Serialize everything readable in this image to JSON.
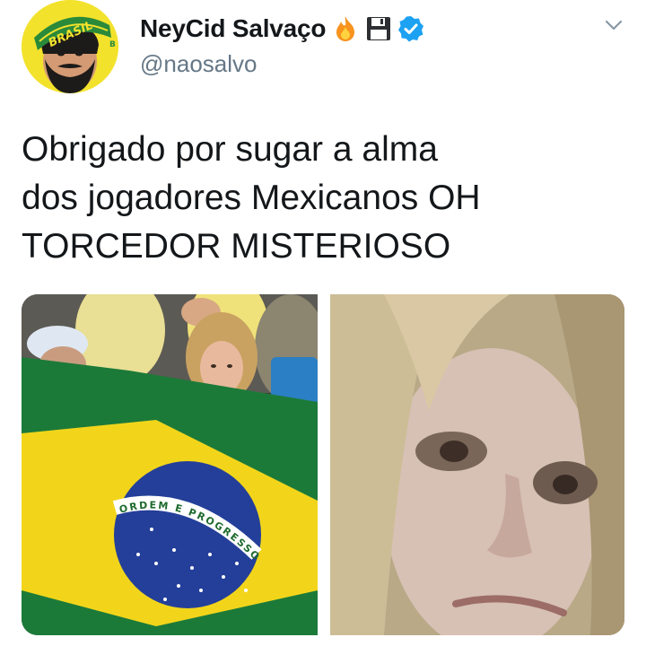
{
  "user": {
    "display_name": "NeyCid Salvaço",
    "handle": "@naosalvo",
    "name_emojis": [
      "fire-icon",
      "floppy-disk-icon",
      "verified-badge-icon"
    ],
    "avatar_band_text": "BRASIL",
    "avatar_band_letter": "B"
  },
  "tweet": {
    "text": "Obrigado por sugar a alma\ndos jogadores Mexicanos OH\nTORCEDOR MISTERIOSO"
  },
  "media": {
    "left_image": "fans-with-brazil-flag-photo",
    "right_image": "blond-long-hair-face-closeup-photo",
    "flag_motto": "ORDEM E PROGRESSO"
  },
  "colors": {
    "text": "#14171a",
    "handle": "#657786",
    "verified": "#1da1f2",
    "avatar_bg": "#f3e22c",
    "flag_green": "#1c7a39",
    "flag_yellow": "#f2d51b",
    "flag_blue": "#243f99"
  }
}
